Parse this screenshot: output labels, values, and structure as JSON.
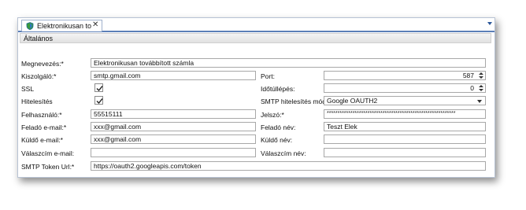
{
  "tab": {
    "title": "Elektronikusan to",
    "close": "✕",
    "icon": "shield-icon"
  },
  "section": {
    "title": "Általános"
  },
  "fields": {
    "name_label": "Megnevezés:*",
    "name_value": "Elektronikusan továbbított számla",
    "server_label": "Kiszolgáló:*",
    "server_value": "smtp.gmail.com",
    "port_label": "Port:",
    "port_value": "587",
    "ssl_label": "SSL",
    "ssl_checked": true,
    "timeout_label": "Időtúllépés:",
    "timeout_value": "0",
    "auth_label": "Hitelesítés",
    "auth_checked": true,
    "auth_mode_label": "SMTP hitelesítés mód:",
    "auth_mode_value": "Google OAUTH2",
    "user_label": "Felhasználó:*",
    "user_value": "55515111",
    "password_label": "Jelszó:*",
    "password_value": "************************************************************",
    "sender_email_label": "Feladó e-mail:*",
    "sender_email_value": "xxx@gmail.com",
    "sender_name_label": "Feladó név:",
    "sender_name_value": "Teszt Elek",
    "send_email_label": "Küldő e-mail:*",
    "send_email_value": "xxx@gmail.com",
    "send_name_label": "Küldő név:",
    "send_name_value": "",
    "reply_email_label": "Válaszcím e-mail:",
    "reply_email_value": "",
    "reply_name_label": "Válaszcím név:",
    "reply_name_value": "",
    "token_url_label": "SMTP Token Url:*",
    "token_url_value": "https://oauth2.googleapis.com/token"
  },
  "colors": {
    "accent": "#5b7fb8",
    "border": "#a8a8a8"
  }
}
